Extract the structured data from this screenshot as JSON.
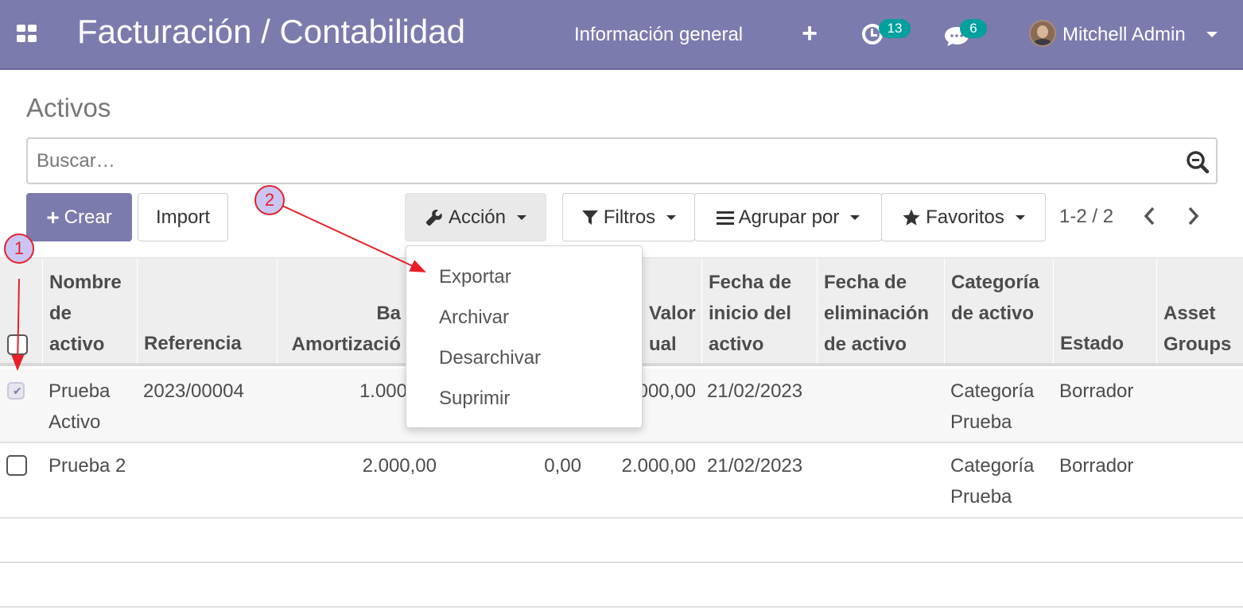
{
  "navbar": {
    "app_title": "Facturación / Contabilidad",
    "menu_item": "Información general",
    "activity_count": "13",
    "message_count": "6",
    "user_name": "Mitchell Admin",
    "bg_color": "#7c7bad",
    "badge_color": "#00a09d"
  },
  "breadcrumb": "Activos",
  "search": {
    "placeholder": "Buscar…"
  },
  "buttons": {
    "create": "Crear",
    "import": "Import",
    "action": "Acción",
    "filters": "Filtros",
    "group_by": "Agrupar por",
    "favorites": "Favoritos"
  },
  "pager": {
    "value": "1-2 / 2"
  },
  "action_menu": {
    "items": [
      "Exportar",
      "Archivar",
      "Desarchivar",
      "Suprimir"
    ]
  },
  "table": {
    "headers": {
      "name": "Nombre de activo",
      "reference": "Referencia",
      "base": "Base Amortización",
      "depreciated": "",
      "book_value": "Valor actual",
      "start_date": "Fecha de inicio del activo",
      "disposal_date": "Fecha de eliminación de activo",
      "category": "Categoría de activo",
      "state": "Estado",
      "asset_groups": "Asset Groups"
    },
    "header_visible": {
      "base_top": "Ba",
      "base_bottom": "Amortizació",
      "value_top": "Valor",
      "value_bottom": "ual"
    },
    "rows": [
      {
        "checked": true,
        "name": "Prueba Activo",
        "reference": "2023/00004",
        "base": "1.000",
        "depreciated": "",
        "book_value": ".000,00",
        "start_date": "21/02/2023",
        "disposal_date": "",
        "category": "Categoría Prueba",
        "state": "Borrador",
        "asset_groups": ""
      },
      {
        "checked": false,
        "name": "Prueba 2",
        "reference": "",
        "base": "2.000,00",
        "depreciated": "0,00",
        "book_value": "2.000,00",
        "start_date": "21/02/2023",
        "disposal_date": "",
        "category": "Categoría Prueba",
        "state": "Borrador",
        "asset_groups": ""
      }
    ]
  },
  "annotations": {
    "step1": "1",
    "step2": "2",
    "color": "#e8202a"
  }
}
